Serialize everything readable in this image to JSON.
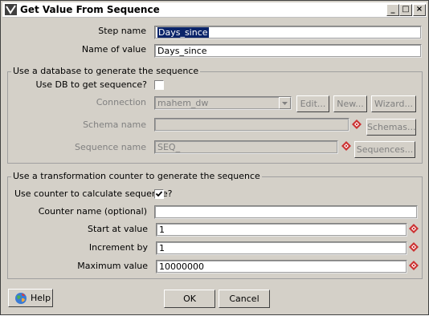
{
  "window": {
    "title": "Get Value From Sequence",
    "controls": {
      "minimize": "_",
      "maximize": "□",
      "close": "×"
    }
  },
  "fields": {
    "step_name_label": "Step name",
    "step_name_value": "Days_since",
    "name_of_value_label": "Name of value",
    "name_of_value_value": "Days_since"
  },
  "db_group": {
    "title": "Use a database to generate the sequence",
    "use_db_label": "Use DB to get sequence?",
    "use_db_checked": false,
    "connection_label": "Connection",
    "connection_value": "mahem_dw",
    "edit_button": "Edit...",
    "new_button": "New...",
    "wizard_button": "Wizard...",
    "schema_label": "Schema name",
    "schema_value": "",
    "schemas_button": "Schemas...",
    "sequence_label": "Sequence name",
    "sequence_value": "SEQ_",
    "sequences_button": "Sequences..."
  },
  "counter_group": {
    "title": "Use a transformation counter to generate the sequence",
    "use_counter_label": "Use counter to calculate sequence?",
    "use_counter_checked": true,
    "counter_name_label": "Counter name (optional)",
    "counter_name_value": "",
    "start_label": "Start at value",
    "start_value": "1",
    "increment_label": "Increment by",
    "increment_value": "1",
    "max_label": "Maximum value",
    "max_value": "10000000"
  },
  "footer": {
    "help_button": "Help",
    "ok_button": "OK",
    "cancel_button": "Cancel"
  },
  "colors": {
    "dialog_bg": "#d4d0c8",
    "selection": "#0a246a",
    "variable_icon": "#cc3333"
  },
  "icons": {
    "variable": "diamond-variable-icon",
    "checkmark": "checkmark-icon",
    "help": "help-globe-icon",
    "dropdown": "chevron-down-icon"
  }
}
